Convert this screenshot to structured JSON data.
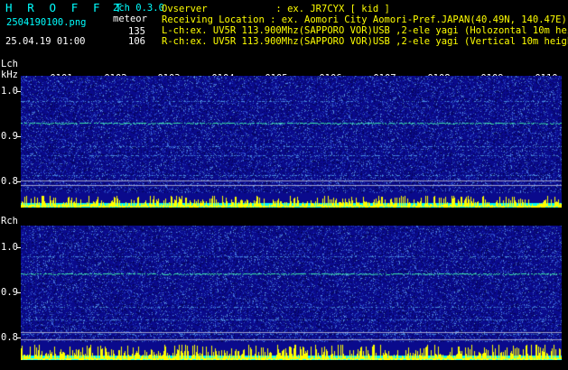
{
  "header": {
    "brand": "H R O F F T",
    "mode": "2ch 0.3.0",
    "filename": "2504190100.png",
    "event_label": "meteor",
    "datetime": "25.04.19 01:00",
    "count_l": "135",
    "count_r": "106",
    "observer": "Ovserver            : ex. JR7CYX [ kid ]",
    "location": "Receiving Location : ex. Aomori City Aomori-Pref.JAPAN(40.49N, 140.47E)",
    "lch_info": "L-ch:ex. UV5R 113.900Mhz(SAPPORO VOR)USB ,2-ele yagi (Holozontal 10m height)",
    "rch_info": "R-ch:ex. UV5R 113.900Mhz(SAPPORO VOR)USB ,2-ele yagi (Vertical 10m height)"
  },
  "left_panel": {
    "channel_label": "Lch",
    "unit_label": "kHz",
    "y_ticks": [
      "1.0",
      "0.9",
      "0.8"
    ]
  },
  "right_panel": {
    "channel_label": "Rch",
    "y_ticks": [
      "1.0",
      "0.9",
      "0.8"
    ]
  },
  "time_ticks": [
    "0101",
    "0102",
    "0103",
    "0104",
    "0105",
    "0106",
    "0107",
    "0108",
    "0109",
    "0110"
  ],
  "colors": {
    "background": "#000000",
    "spectrum_base": "#0a0a8c",
    "signal": "#35e0b0",
    "level_bar": "#ffff00",
    "level_base": "#00ffff",
    "header_text": "#00ffff"
  }
}
